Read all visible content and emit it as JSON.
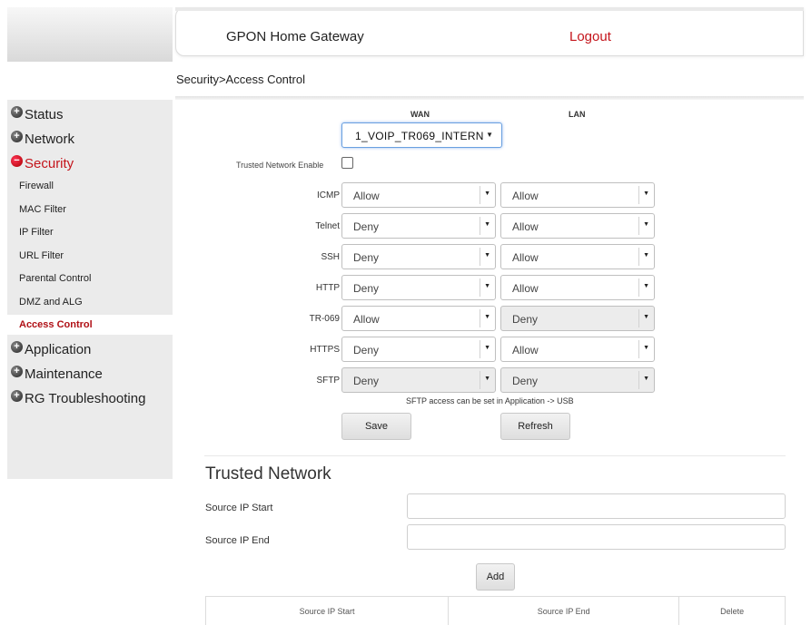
{
  "header": {
    "title": "GPON Home Gateway",
    "logout": "Logout"
  },
  "breadcrumb": "Security>Access Control",
  "sidebar": {
    "sections": [
      {
        "label": "Status",
        "expanded": false
      },
      {
        "label": "Network",
        "expanded": false
      },
      {
        "label": "Security",
        "expanded": true
      },
      {
        "label": "Application",
        "expanded": false
      },
      {
        "label": "Maintenance",
        "expanded": false
      },
      {
        "label": "RG Troubleshooting",
        "expanded": false
      }
    ],
    "security_items": [
      "Firewall",
      "MAC Filter",
      "IP Filter",
      "URL Filter",
      "Parental Control",
      "DMZ and ALG",
      "Access Control"
    ],
    "current_item": "Access Control"
  },
  "access_control": {
    "wan_header": "WAN",
    "lan_header": "LAN",
    "wan_interface": "1_VOIP_TR069_INTERN",
    "trusted_network_label": "Trusted Network Enable",
    "trusted_network_enabled": false,
    "rows": [
      {
        "service": "ICMP",
        "wan": "Allow",
        "lan": "Allow",
        "wan_disabled": false,
        "lan_disabled": false
      },
      {
        "service": "Telnet",
        "wan": "Deny",
        "lan": "Allow",
        "wan_disabled": false,
        "lan_disabled": false
      },
      {
        "service": "SSH",
        "wan": "Deny",
        "lan": "Allow",
        "wan_disabled": false,
        "lan_disabled": false
      },
      {
        "service": "HTTP",
        "wan": "Deny",
        "lan": "Allow",
        "wan_disabled": false,
        "lan_disabled": false
      },
      {
        "service": "TR-069",
        "wan": "Allow",
        "lan": "Deny",
        "wan_disabled": false,
        "lan_disabled": true
      },
      {
        "service": "HTTPS",
        "wan": "Deny",
        "lan": "Allow",
        "wan_disabled": false,
        "lan_disabled": false
      },
      {
        "service": "SFTP",
        "wan": "Deny",
        "lan": "Deny",
        "wan_disabled": true,
        "lan_disabled": true
      }
    ],
    "sftp_note": "SFTP access can be set in Application -> USB",
    "save_label": "Save",
    "refresh_label": "Refresh"
  },
  "trusted_network": {
    "title": "Trusted Network",
    "start_label": "Source IP Start",
    "end_label": "Source IP End",
    "start_value": "",
    "end_value": "",
    "add_label": "Add",
    "table_headers": [
      "Source IP Start",
      "Source IP End",
      "Delete"
    ]
  },
  "colors": {
    "accent_red": "#c4141b",
    "sidebar_bg": "#ebebeb"
  }
}
